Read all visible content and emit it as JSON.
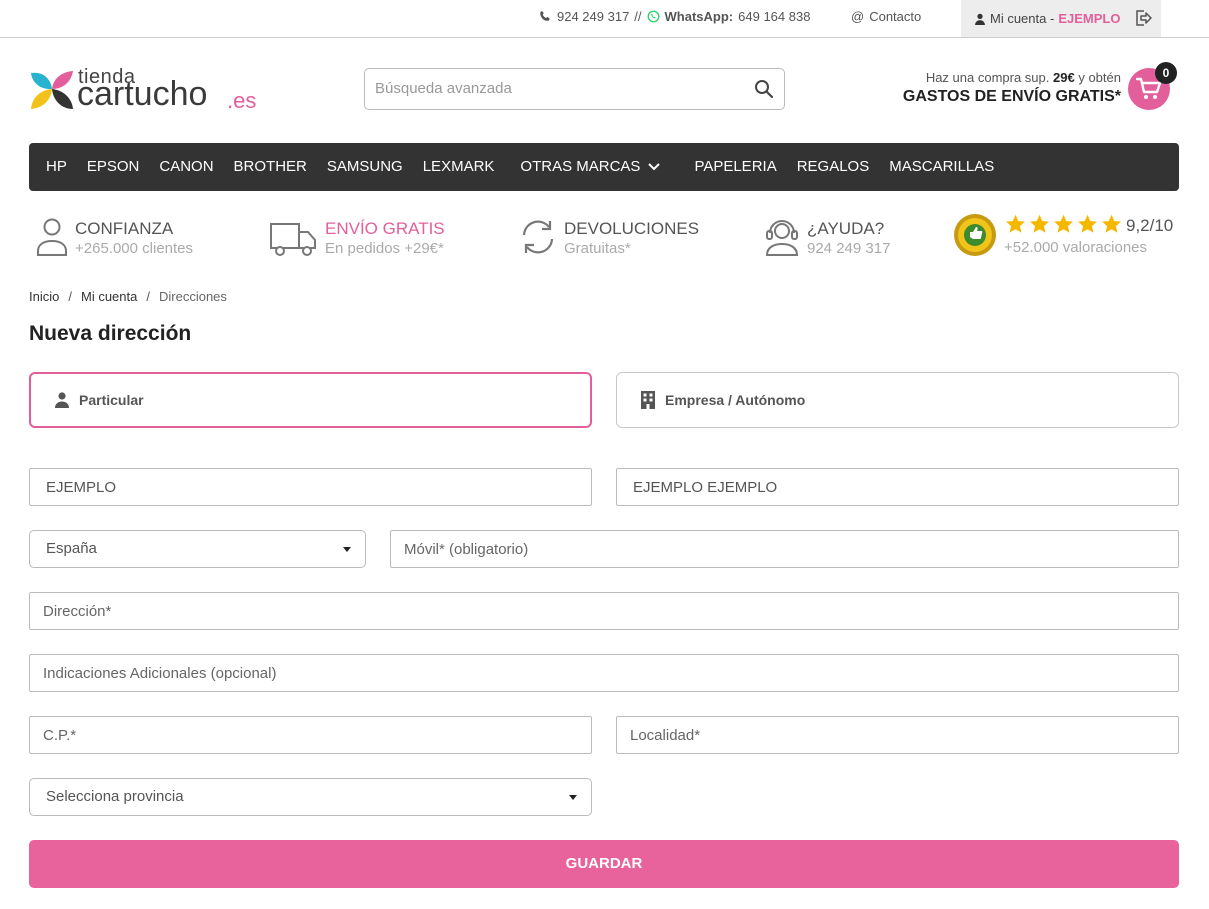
{
  "topbar": {
    "phone": "924 249 317",
    "separator": "//",
    "whatsapp_label": "WhatsApp:",
    "whatsapp_number": "649 164 838",
    "contact_label": "Contacto",
    "account_label": "Mi cuenta -",
    "account_user": "EJEMPLO"
  },
  "logo": {
    "top": "tienda",
    "main": "cartucho",
    "suffix": ".es"
  },
  "search": {
    "placeholder": "Búsqueda avanzada"
  },
  "promo": {
    "line1_prefix": "Haz una compra sup.",
    "line1_amount": "29€",
    "line1_suffix": "y obtén",
    "line2": "GASTOS DE ENVÍO GRATIS*"
  },
  "cart": {
    "count": "0"
  },
  "nav": {
    "items": [
      "HP",
      "EPSON",
      "CANON",
      "BROTHER",
      "SAMSUNG",
      "LEXMARK",
      "OTRAS MARCAS",
      "PAPELERIA",
      "REGALOS",
      "MASCARILLAS"
    ]
  },
  "trust": {
    "confianza": {
      "title": "CONFIANZA",
      "sub": "+265.000 clientes"
    },
    "envio": {
      "title": "ENVÍO GRATIS",
      "sub": "En pedidos +29€*"
    },
    "devoluciones": {
      "title": "DEVOLUCIONES",
      "sub": "Gratuitas*"
    },
    "ayuda": {
      "title": "¿AYUDA?",
      "sub": "924 249 317"
    },
    "rating": {
      "value": "9,2/10",
      "sub": "+52.000 valoraciones",
      "stars": 5
    }
  },
  "breadcrumb": [
    "Inicio",
    "/",
    "Mi cuenta",
    "/",
    "Direcciones"
  ],
  "page_title": "Nueva dirección",
  "type_options": {
    "particular": "Particular",
    "empresa": "Empresa / Autónomo",
    "selected": "particular"
  },
  "form": {
    "nombre_value": "EJEMPLO",
    "apellidos_value": "EJEMPLO EJEMPLO",
    "pais_value": "España",
    "movil_placeholder": "Móvil* (obligatorio)",
    "direccion_placeholder": "Dirección*",
    "indicaciones_placeholder": "Indicaciones Adicionales (opcional)",
    "cp_placeholder": "C.P.*",
    "localidad_placeholder": "Localidad*",
    "provincia_value": "Selecciona provincia",
    "save_label": "GUARDAR"
  },
  "colors": {
    "accent": "#e35f9c",
    "nav_bg": "#333333",
    "star": "#f5b800"
  }
}
